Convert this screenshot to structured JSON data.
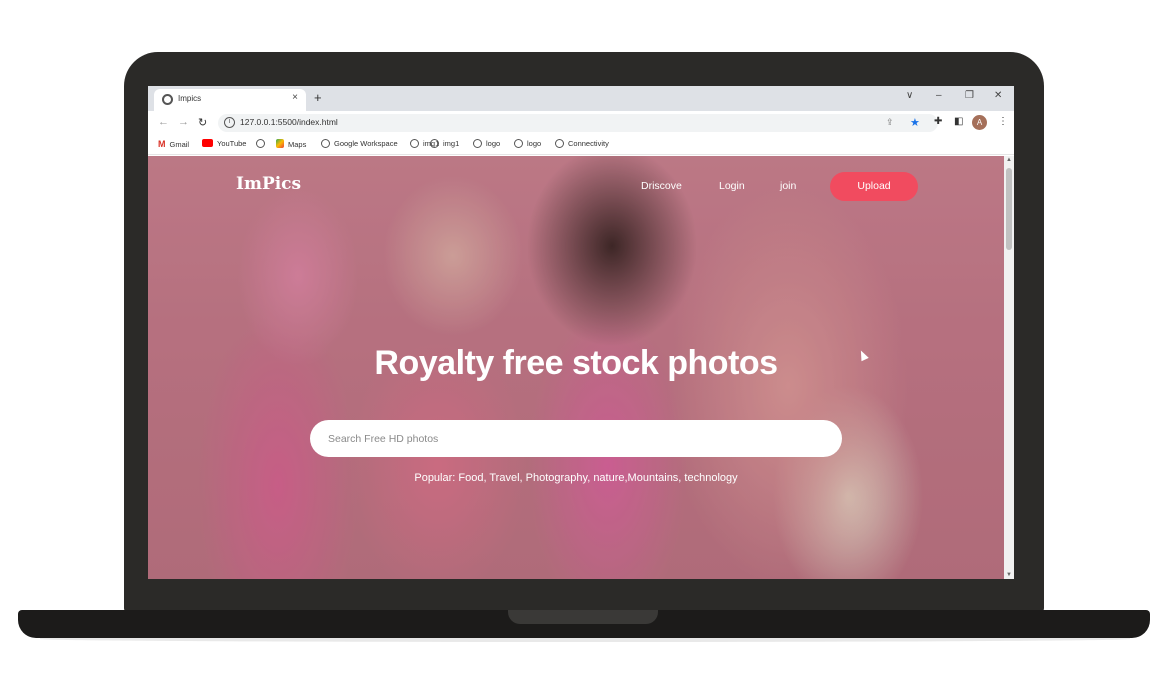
{
  "browser": {
    "tab_title": "Impics",
    "tab_close": "×",
    "new_tab": "+",
    "url": "127.0.0.1:5500/index.html",
    "controls": {
      "collapse": "∨",
      "minimize": "–",
      "restore": "❐",
      "close": "✕"
    },
    "avatar_letter": "A",
    "bookmarks": [
      {
        "label": "Gmail",
        "icon": "gmail-icon"
      },
      {
        "label": "YouTube",
        "icon": "youtube-icon"
      },
      {
        "label": "",
        "icon": "globe-icon"
      },
      {
        "label": "Maps",
        "icon": "maps-icon"
      },
      {
        "label": "Google Workspace",
        "icon": "globe-icon"
      },
      {
        "label": "img1",
        "icon": "globe-icon"
      },
      {
        "label": "logo",
        "icon": "globe-icon"
      },
      {
        "label": "logo",
        "icon": "globe-icon"
      },
      {
        "label": "Connectivity",
        "icon": "globe-icon"
      }
    ]
  },
  "site": {
    "logo": "ImPics",
    "nav": [
      "Driscove",
      "Login",
      "join"
    ],
    "upload_label": "Upload",
    "hero_title": "Royalty free stock photos",
    "search_placeholder": "Search Free HD photos",
    "popular": "Popular: Food, Travel, Photography, nature,Mountains, technology",
    "accent_color": "#f14b5f"
  }
}
